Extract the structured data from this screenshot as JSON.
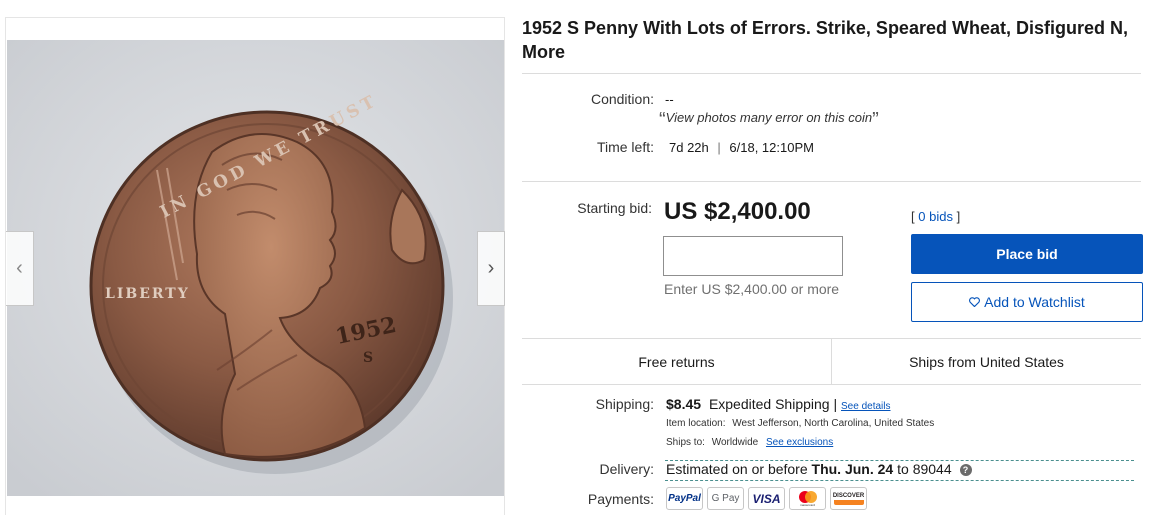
{
  "gallery": {
    "prev_arrow": "‹",
    "next_arrow": "›",
    "coin": {
      "legend_top": "IN GOD WE TRUST",
      "legend_left": "LIBERTY",
      "year": "1952",
      "mint_mark": "S"
    }
  },
  "listing": {
    "title": "1952 S Penny With Lots of Errors. Strike, Speared Wheat, Disfigured N, More"
  },
  "details": {
    "condition_label": "Condition:",
    "condition_value": "--",
    "seller_note": "View photos many error on this coin",
    "quote_open": "“",
    "quote_close": "”",
    "time_left_label": "Time left:",
    "time_left_value": "7d 22h",
    "end_time": "6/18, 12:10PM"
  },
  "bidding": {
    "starting_bid_label": "Starting bid:",
    "price": "US $2,400.00",
    "bid_input_value": "",
    "bid_hint": "Enter US $2,400.00 or more",
    "bids_open": "[",
    "bids_link": "0 bids",
    "bids_close": "]",
    "place_bid_label": "Place bid",
    "watchlist_label": "Add to Watchlist"
  },
  "info_bar": {
    "returns": "Free returns",
    "ships_from": "Ships from United States"
  },
  "shipping": {
    "label": "Shipping:",
    "cost": "$8.45",
    "service": "Expedited Shipping",
    "separator": "|",
    "details_link": "See details",
    "item_location_label": "Item location:",
    "item_location": "West Jefferson, North Carolina, United States",
    "ships_to_label": "Ships to:",
    "ships_to": "Worldwide",
    "exclusions_link": "See exclusions"
  },
  "delivery": {
    "label": "Delivery:",
    "prefix": "Estimated on or before",
    "date": "Thu. Jun. 24",
    "to": "to",
    "zip": "89044",
    "help_icon": "?"
  },
  "payments": {
    "label": "Payments:",
    "methods": [
      {
        "name": "PayPal",
        "color": "#003087",
        "accent": "#009cde"
      },
      {
        "name": "G Pay",
        "color": "#5f6368"
      },
      {
        "name": "VISA",
        "color": "#1a1f71"
      },
      {
        "name": "mastercard",
        "color": "#eb001b",
        "accent": "#f79e1b"
      },
      {
        "name": "DISCOVER",
        "color": "#231f20",
        "accent": "#f58220"
      }
    ]
  },
  "colors": {
    "accent_blue": "#0654ba",
    "divider": "#dcdcdc"
  }
}
